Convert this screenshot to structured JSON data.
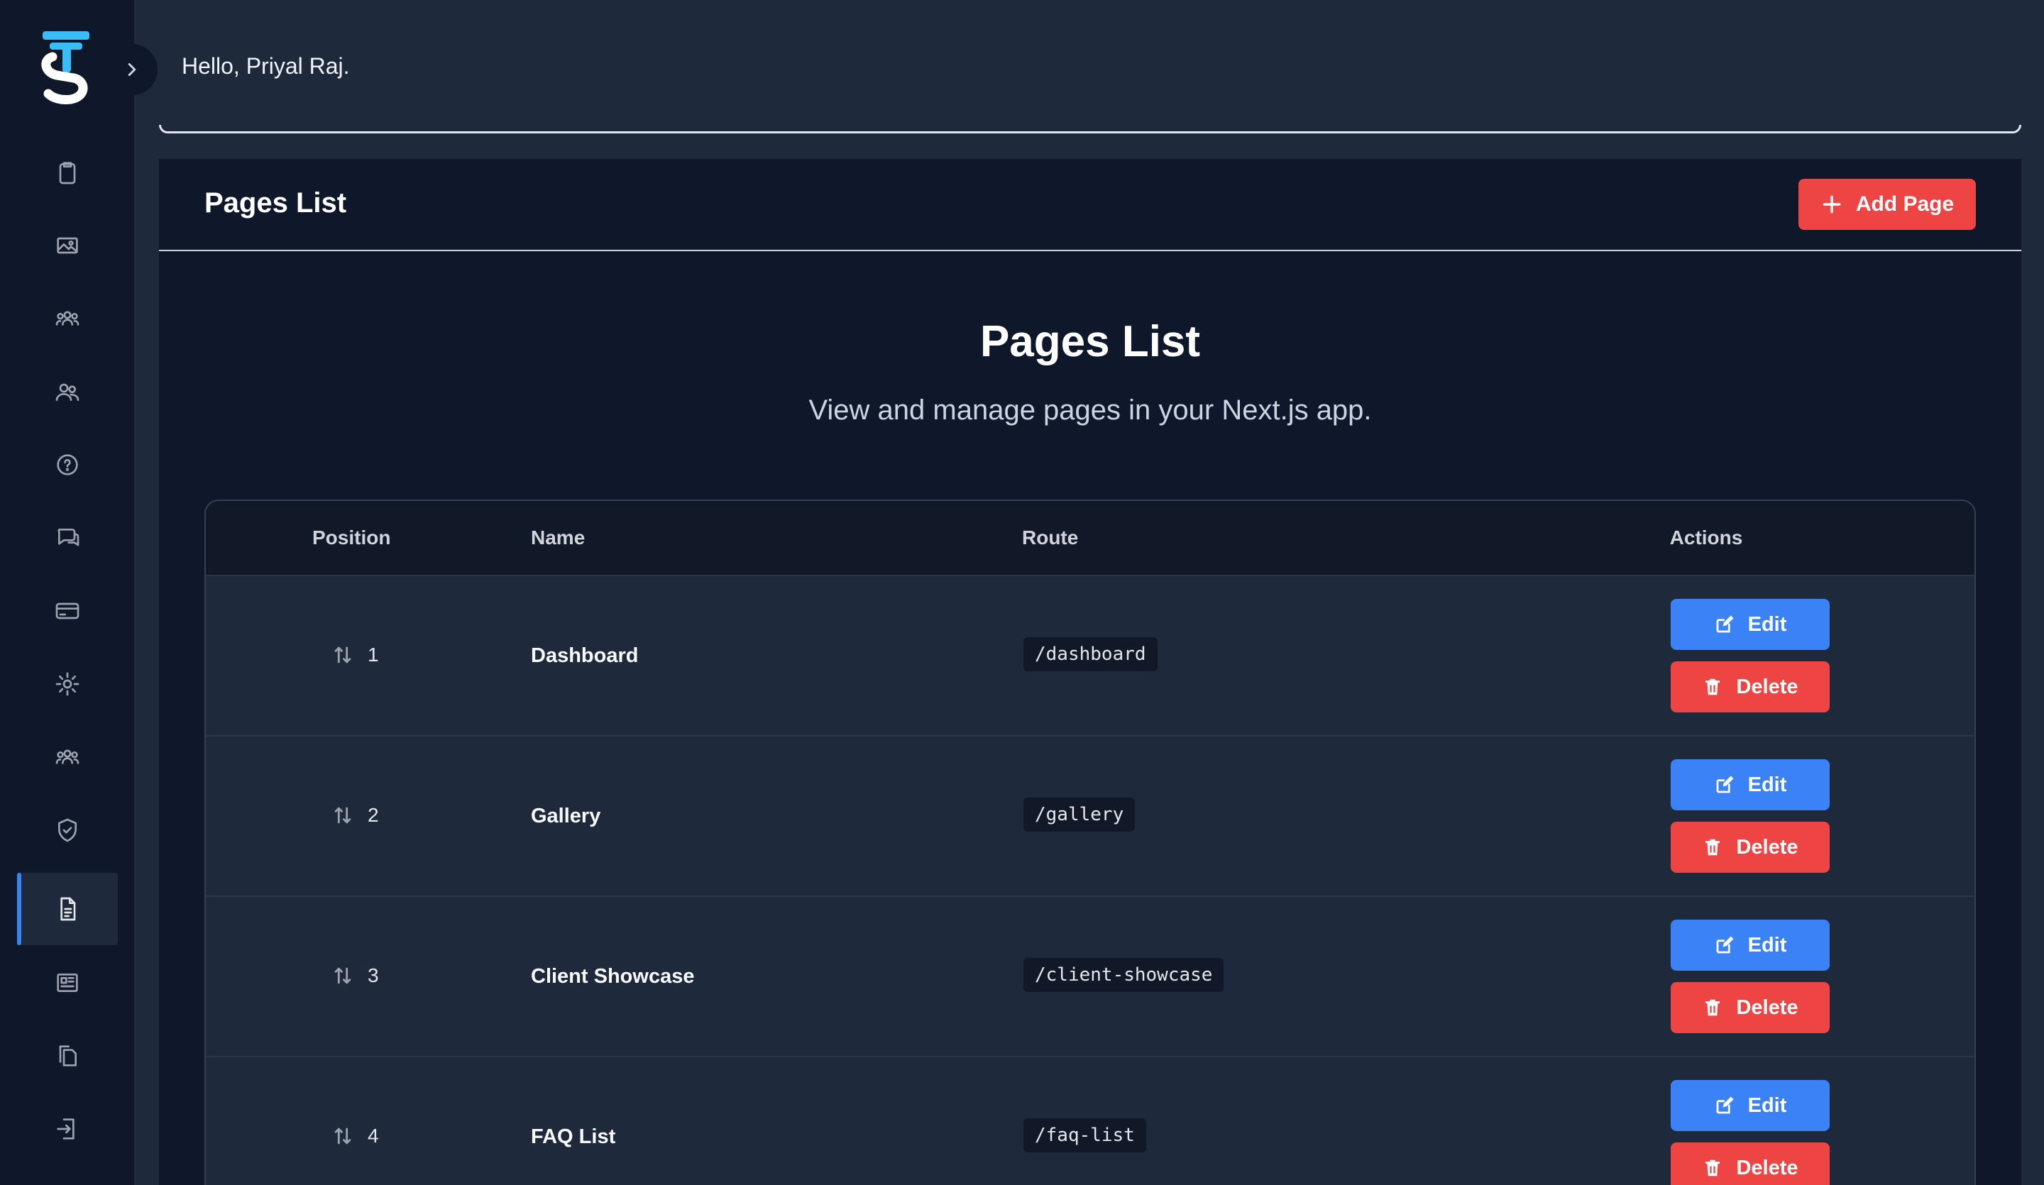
{
  "header": {
    "greeting": "Hello, Priyal Raj."
  },
  "sidebar": {
    "items": [
      {
        "icon": "clipboard-icon",
        "active": false
      },
      {
        "icon": "image-icon",
        "active": false
      },
      {
        "icon": "users-group-icon",
        "active": false
      },
      {
        "icon": "users-icon",
        "active": false
      },
      {
        "icon": "question-icon",
        "active": false
      },
      {
        "icon": "chat-icon",
        "active": false
      },
      {
        "icon": "credit-card-icon",
        "active": false
      },
      {
        "icon": "gear-icon",
        "active": false
      },
      {
        "icon": "team-icon",
        "active": false
      },
      {
        "icon": "shield-check-icon",
        "active": false
      },
      {
        "icon": "document-icon",
        "active": true
      },
      {
        "icon": "newspaper-icon",
        "active": false
      },
      {
        "icon": "copy-icon",
        "active": false
      },
      {
        "icon": "logout-icon",
        "active": false
      }
    ]
  },
  "panel": {
    "title": "Pages List",
    "add_button": "Add Page",
    "hero_title": "Pages List",
    "hero_subtitle": "View and manage pages in your Next.js app."
  },
  "table": {
    "columns": [
      "Position",
      "Name",
      "Route",
      "Actions"
    ],
    "rows": [
      {
        "position": "1",
        "name": "Dashboard",
        "route": "/dashboard",
        "edit": "Edit",
        "delete": "Delete"
      },
      {
        "position": "2",
        "name": "Gallery",
        "route": "/gallery",
        "edit": "Edit",
        "delete": "Delete"
      },
      {
        "position": "3",
        "name": "Client Showcase",
        "route": "/client-showcase",
        "edit": "Edit",
        "delete": "Delete"
      },
      {
        "position": "4",
        "name": "FAQ List",
        "route": "/faq-list",
        "edit": "Edit",
        "delete": "Delete"
      }
    ]
  },
  "colors": {
    "accent_blue": "#3b82f6",
    "danger_red": "#ef4444",
    "logo_blue": "#38bdf8"
  }
}
